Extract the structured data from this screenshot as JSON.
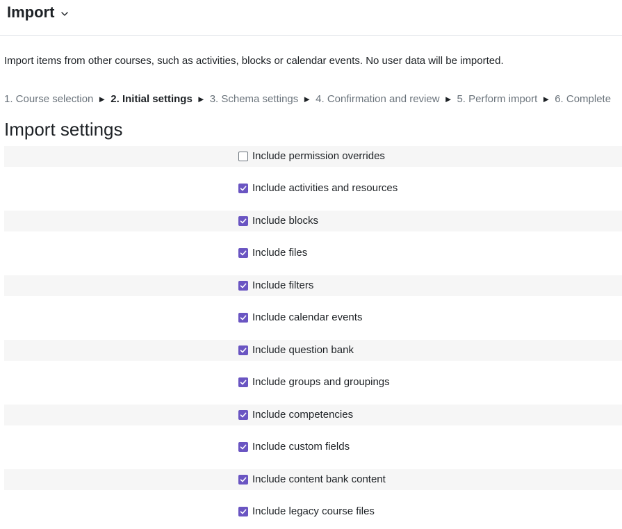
{
  "header": {
    "title": "Import",
    "menu_icon": "chevron-down-icon"
  },
  "intro_text": "Import items from other courses, such as activities, blocks or calendar events. No user data will be imported.",
  "steps": [
    {
      "label": "1. Course selection",
      "current": false
    },
    {
      "label": "2. Initial settings",
      "current": true
    },
    {
      "label": "3. Schema settings",
      "current": false
    },
    {
      "label": "4. Confirmation and review",
      "current": false
    },
    {
      "label": "5. Perform import",
      "current": false
    },
    {
      "label": "6. Complete",
      "current": false
    }
  ],
  "step_separator": "►",
  "section_title": "Import settings",
  "settings": [
    {
      "label": "Include permission overrides",
      "checked": false
    },
    {
      "label": "Include activities and resources",
      "checked": true
    },
    {
      "label": "Include blocks",
      "checked": true
    },
    {
      "label": "Include files",
      "checked": true
    },
    {
      "label": "Include filters",
      "checked": true
    },
    {
      "label": "Include calendar events",
      "checked": true
    },
    {
      "label": "Include question bank",
      "checked": true
    },
    {
      "label": "Include groups and groupings",
      "checked": true
    },
    {
      "label": "Include competencies",
      "checked": true
    },
    {
      "label": "Include custom fields",
      "checked": true
    },
    {
      "label": "Include content bank content",
      "checked": true
    },
    {
      "label": "Include legacy course files",
      "checked": true
    }
  ],
  "colors": {
    "accent": "#6a55c2",
    "row_shade": "#f6f6f6",
    "muted_text": "#6a737b",
    "text": "#1d2125"
  }
}
